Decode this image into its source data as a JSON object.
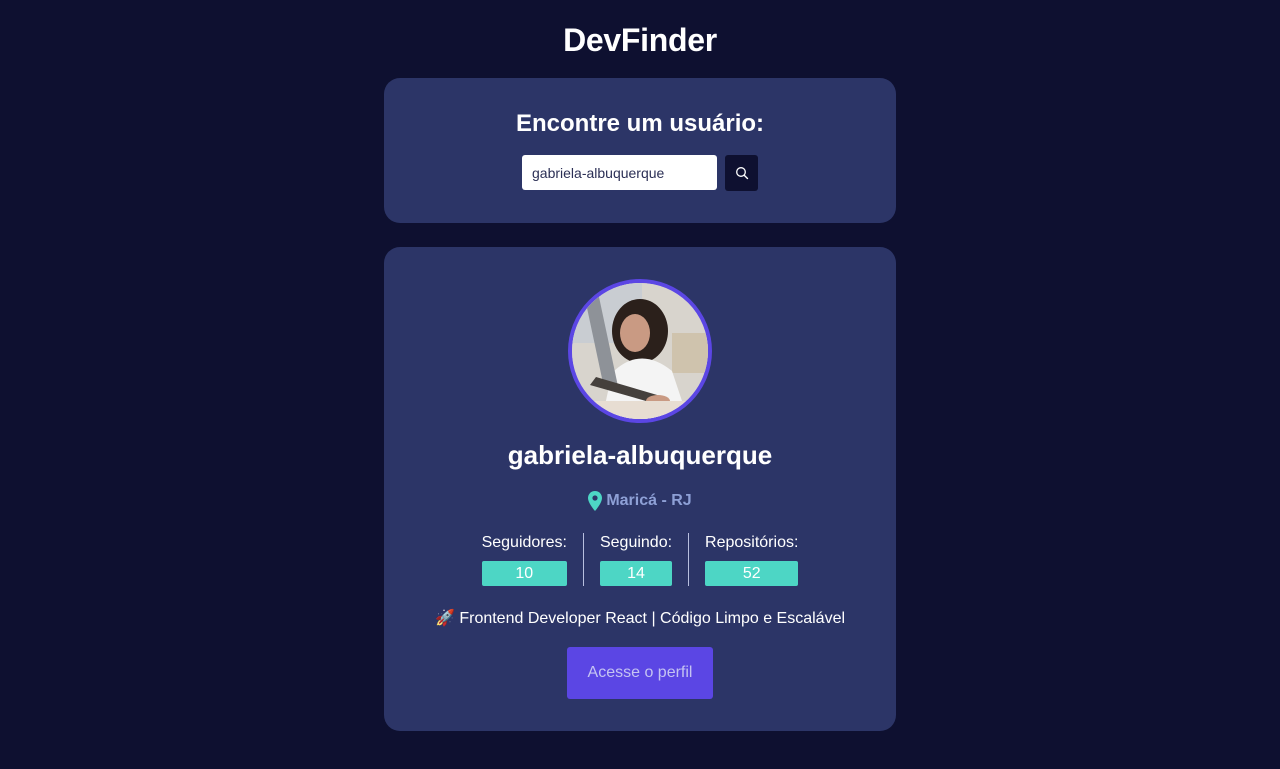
{
  "app": {
    "title": "DevFinder"
  },
  "search": {
    "heading": "Encontre um usuário:",
    "value": "gabriela-albuquerque",
    "button_icon": "search-icon"
  },
  "profile": {
    "avatar_icon": "user-avatar",
    "username": "gabriela-albuquerque",
    "location": "Maricá - RJ",
    "location_icon": "map-pin-icon",
    "stats": [
      {
        "label": "Seguidores:",
        "value": "10"
      },
      {
        "label": "Seguindo:",
        "value": "14"
      },
      {
        "label": "Repositórios:",
        "value": "52"
      }
    ],
    "bio": "🚀 Frontend Developer React | Código Limpo e Escalável",
    "button_label": "Acesse o perfil"
  },
  "colors": {
    "background": "#0e1030",
    "card": "#2c3567",
    "accent": "#5b46e4",
    "teal": "#4dd6c5",
    "location_text": "#8ea0d6"
  }
}
